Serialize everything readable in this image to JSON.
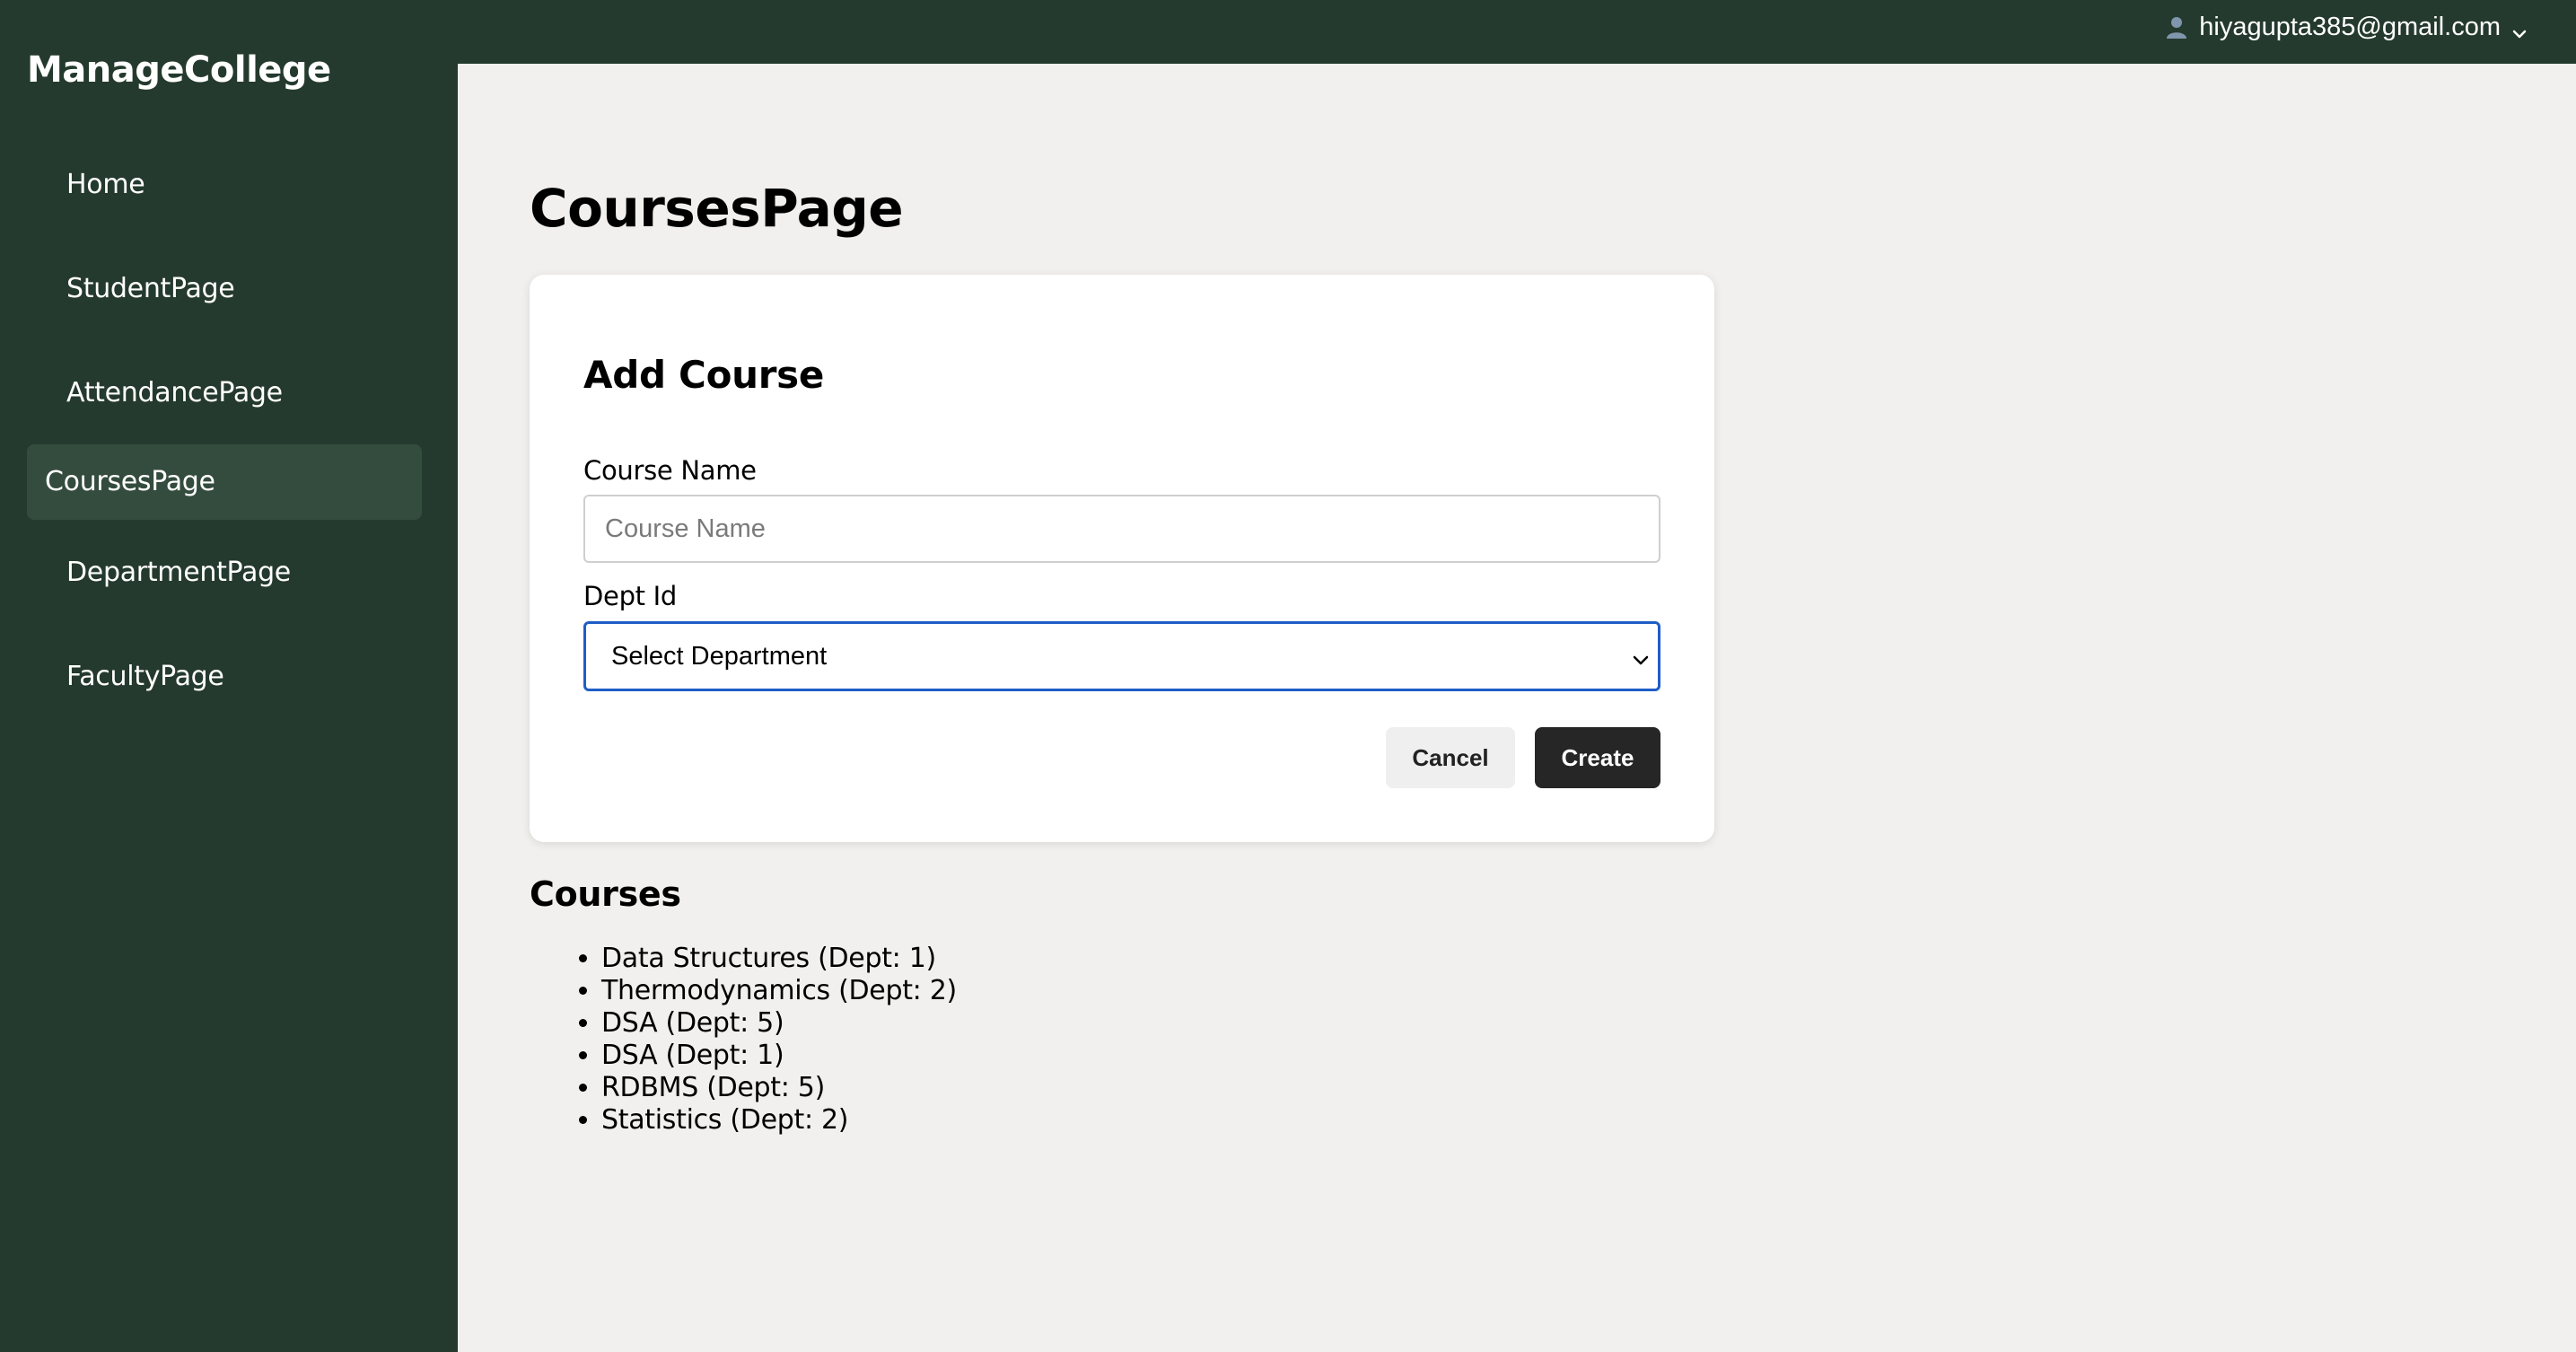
{
  "app": {
    "brand": "ManageCollege"
  },
  "header": {
    "user_email": "hiyagupta385@gmail.com",
    "user_icon": "user-icon",
    "menu_icon": "chevron-down-icon"
  },
  "sidebar": {
    "items": [
      {
        "label": "Home",
        "active": false
      },
      {
        "label": "StudentPage",
        "active": false
      },
      {
        "label": "AttendancePage",
        "active": false
      },
      {
        "label": "CoursesPage",
        "active": true
      },
      {
        "label": "DepartmentPage",
        "active": false
      },
      {
        "label": "FacultyPage",
        "active": false
      }
    ]
  },
  "main": {
    "page_title": "CoursesPage",
    "form": {
      "title": "Add Course",
      "course_name_label": "Course Name",
      "course_name_placeholder": "Course Name",
      "course_name_value": "",
      "dept_label": "Dept Id",
      "dept_selected": "Select Department",
      "cancel_label": "Cancel",
      "create_label": "Create"
    },
    "courses_title": "Courses",
    "courses": [
      "Data Structures (Dept: 1)",
      "Thermodynamics (Dept: 2)",
      "DSA (Dept: 5)",
      "DSA (Dept: 1)",
      "RDBMS (Dept: 5)",
      "Statistics (Dept: 2)"
    ]
  },
  "colors": {
    "sidebar_bg": "#253a2e",
    "active_item_bg": "#344c3e",
    "content_bg": "#f1f0ee",
    "focus_border": "#1f5dc6",
    "primary_button": "#262626"
  }
}
